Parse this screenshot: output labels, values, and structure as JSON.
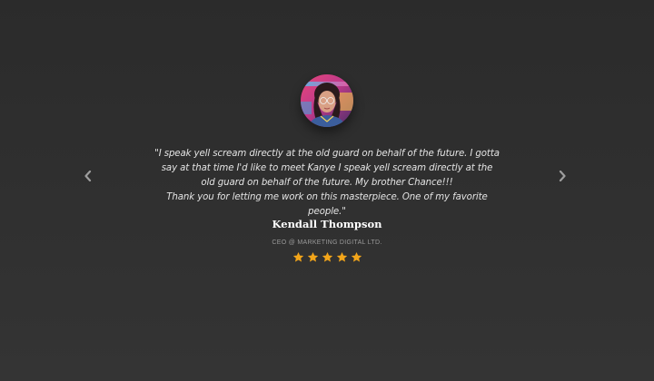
{
  "testimonial": {
    "quote_line_1": "\"I speak yell scream directly at the old guard on behalf of the future. I gotta say at that time I'd like to meet Kanye I speak yell scream directly at the old guard on behalf of the future. My brother Chance!!!",
    "quote_line_2": "Thank you for letting me work on this masterpiece. One of my favorite people.\"",
    "name": "Kendall Thompson",
    "role": "CEO @ Marketing Digital Ltd.",
    "rating": 5,
    "rating_max": 5
  },
  "icons": {
    "prev": "chevron-left-icon",
    "next": "chevron-right-icon",
    "star": "star-icon"
  },
  "colors": {
    "background": "#2f2f2f",
    "star": "#f2a51a",
    "arrow": "#9e9e9e",
    "quote_text": "#e4e4e4",
    "role_text": "#9a9a9a"
  }
}
